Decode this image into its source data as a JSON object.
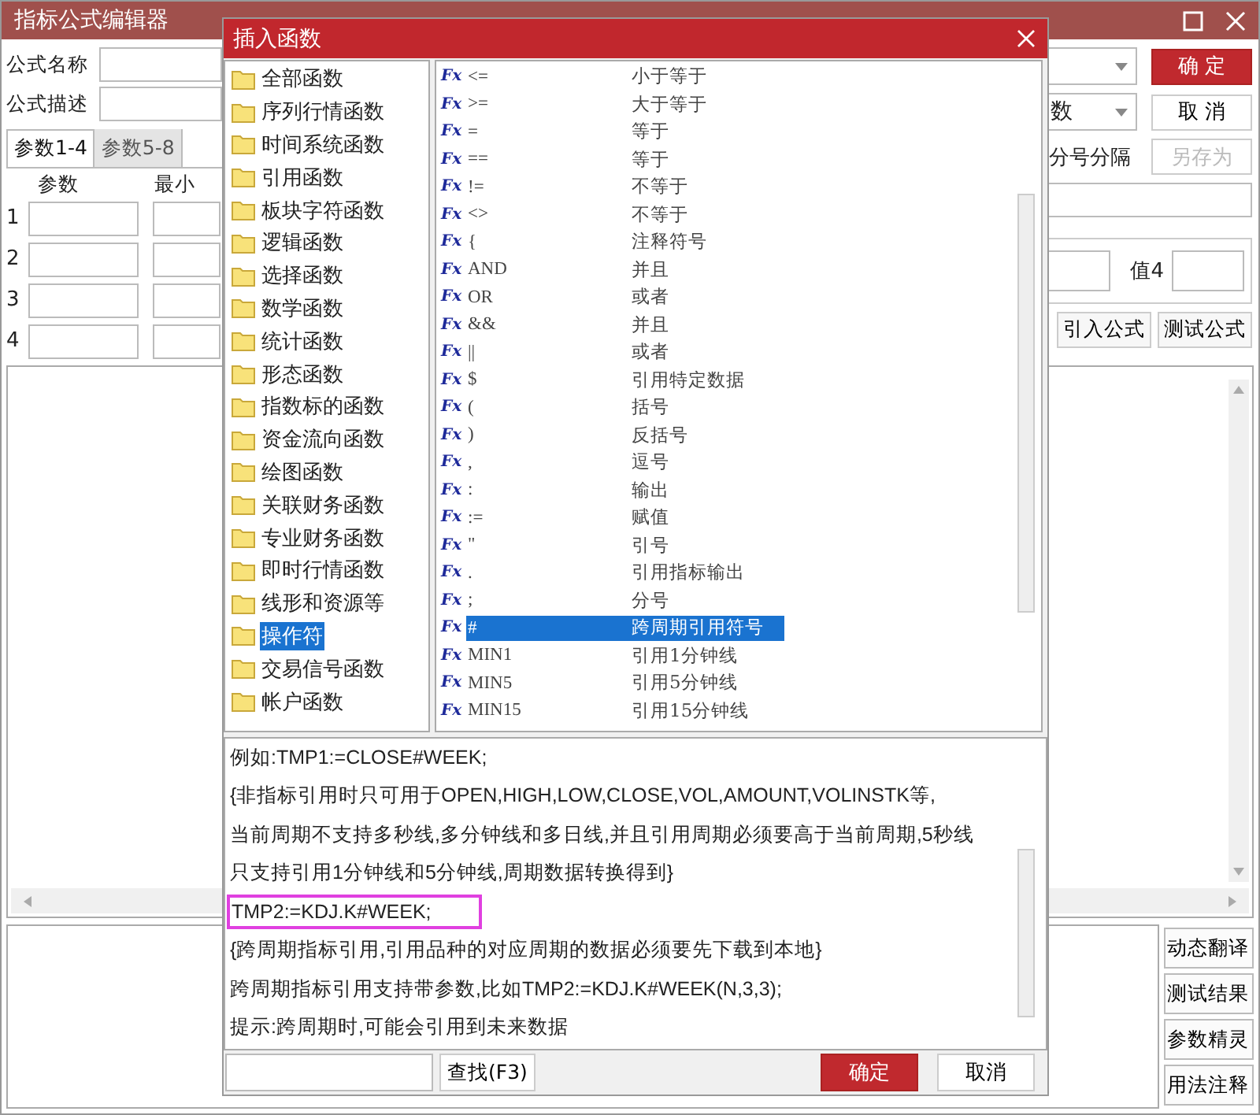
{
  "window": {
    "title": "指标公式编辑器"
  },
  "formula_fields": [
    {
      "label": "公式名称"
    },
    {
      "label": "公式描述"
    }
  ],
  "param_tabs": [
    {
      "label": "参数1-4",
      "selected": true
    },
    {
      "label": "参数5-8",
      "selected": false
    }
  ],
  "param_columns": [
    "参数",
    "最小"
  ],
  "param_rows": [
    "1",
    "2",
    "3",
    "4"
  ],
  "right_panel": {
    "type_value": "数",
    "confirm": "确 定",
    "cancel": "取 消",
    "save_as": {
      "label": "另存为",
      "disabled": true
    },
    "separator_label": "分号分隔",
    "value_label": "值4",
    "buttons": [
      "引入公式",
      "测试公式"
    ]
  },
  "side_buttons": [
    "动态翻译",
    "测试结果",
    "参数精灵",
    "用法注释"
  ],
  "dialog": {
    "title": "插入函数",
    "categories": [
      {
        "label": "全部函数",
        "selected": false
      },
      {
        "label": "序列行情函数",
        "selected": false
      },
      {
        "label": "时间系统函数",
        "selected": false
      },
      {
        "label": "引用函数",
        "selected": false
      },
      {
        "label": "板块字符函数",
        "selected": false
      },
      {
        "label": "逻辑函数",
        "selected": false
      },
      {
        "label": "选择函数",
        "selected": false
      },
      {
        "label": "数学函数",
        "selected": false
      },
      {
        "label": "统计函数",
        "selected": false
      },
      {
        "label": "形态函数",
        "selected": false
      },
      {
        "label": "指数标的函数",
        "selected": false
      },
      {
        "label": "资金流向函数",
        "selected": false
      },
      {
        "label": "绘图函数",
        "selected": false
      },
      {
        "label": "关联财务函数",
        "selected": false
      },
      {
        "label": "专业财务函数",
        "selected": false
      },
      {
        "label": "即时行情函数",
        "selected": false
      },
      {
        "label": "线形和资源等",
        "selected": false
      },
      {
        "label": "操作符",
        "selected": true
      },
      {
        "label": "交易信号函数",
        "selected": false
      },
      {
        "label": "帐户函数",
        "selected": false
      }
    ],
    "functions": [
      {
        "icon": "Fx",
        "name": "<=",
        "description": "小于等于",
        "selected": false
      },
      {
        "icon": "Fx",
        "name": ">=",
        "description": "大于等于",
        "selected": false
      },
      {
        "icon": "Fx",
        "name": "=",
        "description": "等于",
        "selected": false
      },
      {
        "icon": "Fx",
        "name": "==",
        "description": "等于",
        "selected": false
      },
      {
        "icon": "Fx",
        "name": "!=",
        "description": "不等于",
        "selected": false
      },
      {
        "icon": "Fx",
        "name": "<>",
        "description": "不等于",
        "selected": false
      },
      {
        "icon": "Fx",
        "name": "{",
        "description": "注释符号",
        "selected": false
      },
      {
        "icon": "Fx",
        "name": "AND",
        "description": "并且",
        "selected": false
      },
      {
        "icon": "Fx",
        "name": "OR",
        "description": "或者",
        "selected": false
      },
      {
        "icon": "Fx",
        "name": "&&",
        "description": "并且",
        "selected": false
      },
      {
        "icon": "Fx",
        "name": "||",
        "description": "或者",
        "selected": false
      },
      {
        "icon": "Fx",
        "name": "$",
        "description": "引用特定数据",
        "selected": false
      },
      {
        "icon": "Fx",
        "name": "(",
        "description": "括号",
        "selected": false
      },
      {
        "icon": "Fx",
        "name": ")",
        "description": "反括号",
        "selected": false
      },
      {
        "icon": "Fx",
        "name": ",",
        "description": "逗号",
        "selected": false
      },
      {
        "icon": "Fx",
        "name": ":",
        "description": "输出",
        "selected": false
      },
      {
        "icon": "Fx",
        "name": ":=",
        "description": "赋值",
        "selected": false
      },
      {
        "icon": "Fx",
        "name": "\"",
        "description": "引号",
        "selected": false
      },
      {
        "icon": "Fx",
        "name": ".",
        "description": "引用指标输出",
        "selected": false
      },
      {
        "icon": "Fx",
        "name": ";",
        "description": "分号",
        "selected": false
      },
      {
        "icon": "Fx",
        "name": "#",
        "description": "跨周期引用符号",
        "selected": true
      },
      {
        "icon": "Fx",
        "name": "MIN1",
        "description": "引用1分钟线",
        "selected": false
      },
      {
        "icon": "Fx",
        "name": "MIN5",
        "description": "引用5分钟线",
        "selected": false
      },
      {
        "icon": "Fx",
        "name": "MIN15",
        "description": "引用15分钟线",
        "selected": false
      }
    ],
    "description_lines": [
      {
        "text": "例如:TMP1:=CLOSE#WEEK;",
        "highlighted": false
      },
      {
        "text": "{非指标引用时只可用于OPEN,HIGH,LOW,CLOSE,VOL,AMOUNT,VOLINSTK等,",
        "highlighted": false
      },
      {
        "text": "当前周期不支持多秒线,多分钟线和多日线,并且引用周期必须要高于当前周期,5秒线",
        "highlighted": false
      },
      {
        "text": "只支持引用1分钟线和5分钟线,周期数据转换得到}",
        "highlighted": false
      },
      {
        "text": "TMP2:=KDJ.K#WEEK;",
        "highlighted": true
      },
      {
        "text": "{跨周期指标引用,引用品种的对应周期的数据必须要先下载到本地}",
        "highlighted": false
      },
      {
        "text": "跨周期指标引用支持带参数,比如TMP2:=KDJ.K#WEEK(N,3,3);",
        "highlighted": false
      },
      {
        "text": "提示:跨周期时,可能会引用到未来数据",
        "highlighted": false
      }
    ],
    "search_button": "查找(F3)",
    "buttons": [
      {
        "label": "确定",
        "kind": "primary"
      },
      {
        "label": "取消",
        "kind": "secondary"
      }
    ]
  }
}
